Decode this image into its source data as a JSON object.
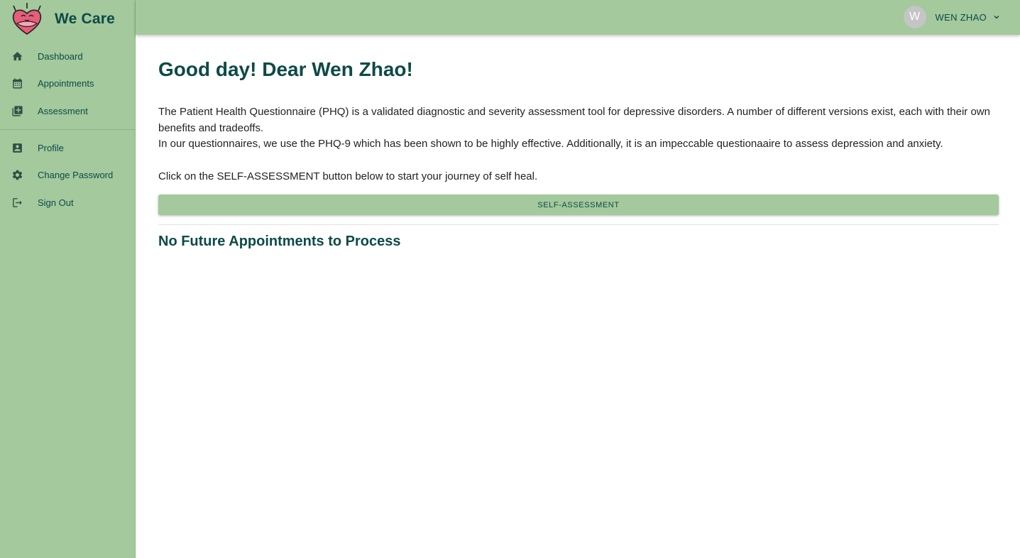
{
  "brand": {
    "name": "We Care",
    "logo_icon": "heart-mascot-icon"
  },
  "sidebar": {
    "items": [
      {
        "label": "Dashboard",
        "icon": "home-icon"
      },
      {
        "label": "Appointments",
        "icon": "calendar-icon"
      },
      {
        "label": "Assessment",
        "icon": "book-icon"
      },
      {
        "label": "Profile",
        "icon": "account-box-icon"
      },
      {
        "label": "Change Password",
        "icon": "gear-icon"
      },
      {
        "label": "Sign Out",
        "icon": "logout-icon"
      }
    ]
  },
  "header": {
    "avatar_initial": "W",
    "user_name": "WEN ZHAO"
  },
  "main": {
    "greeting": "Good day! Dear Wen Zhao!",
    "paragraph1": "The Patient Health Questionnaire (PHQ) is a validated diagnostic and severity assessment tool for depressive disorders. A number of different versions exist, each with their own benefits and tradeoffs.",
    "paragraph2": "In our questionnaires, we use the PHQ-9 which has been shown to be highly effective. Additionally, it is an impeccable questionaaire to assess depression and anxiety.",
    "paragraph3": "Click on the SELF-ASSESSMENT button below to start your journey of self heal.",
    "button_label": "SELF-ASSESSMENT",
    "appointments_status": "No Future Appointments to Process"
  },
  "colors": {
    "accent": "#a3c99c",
    "text_dark_teal": "#0d4a47",
    "logo_pink": "#e85d7a"
  }
}
